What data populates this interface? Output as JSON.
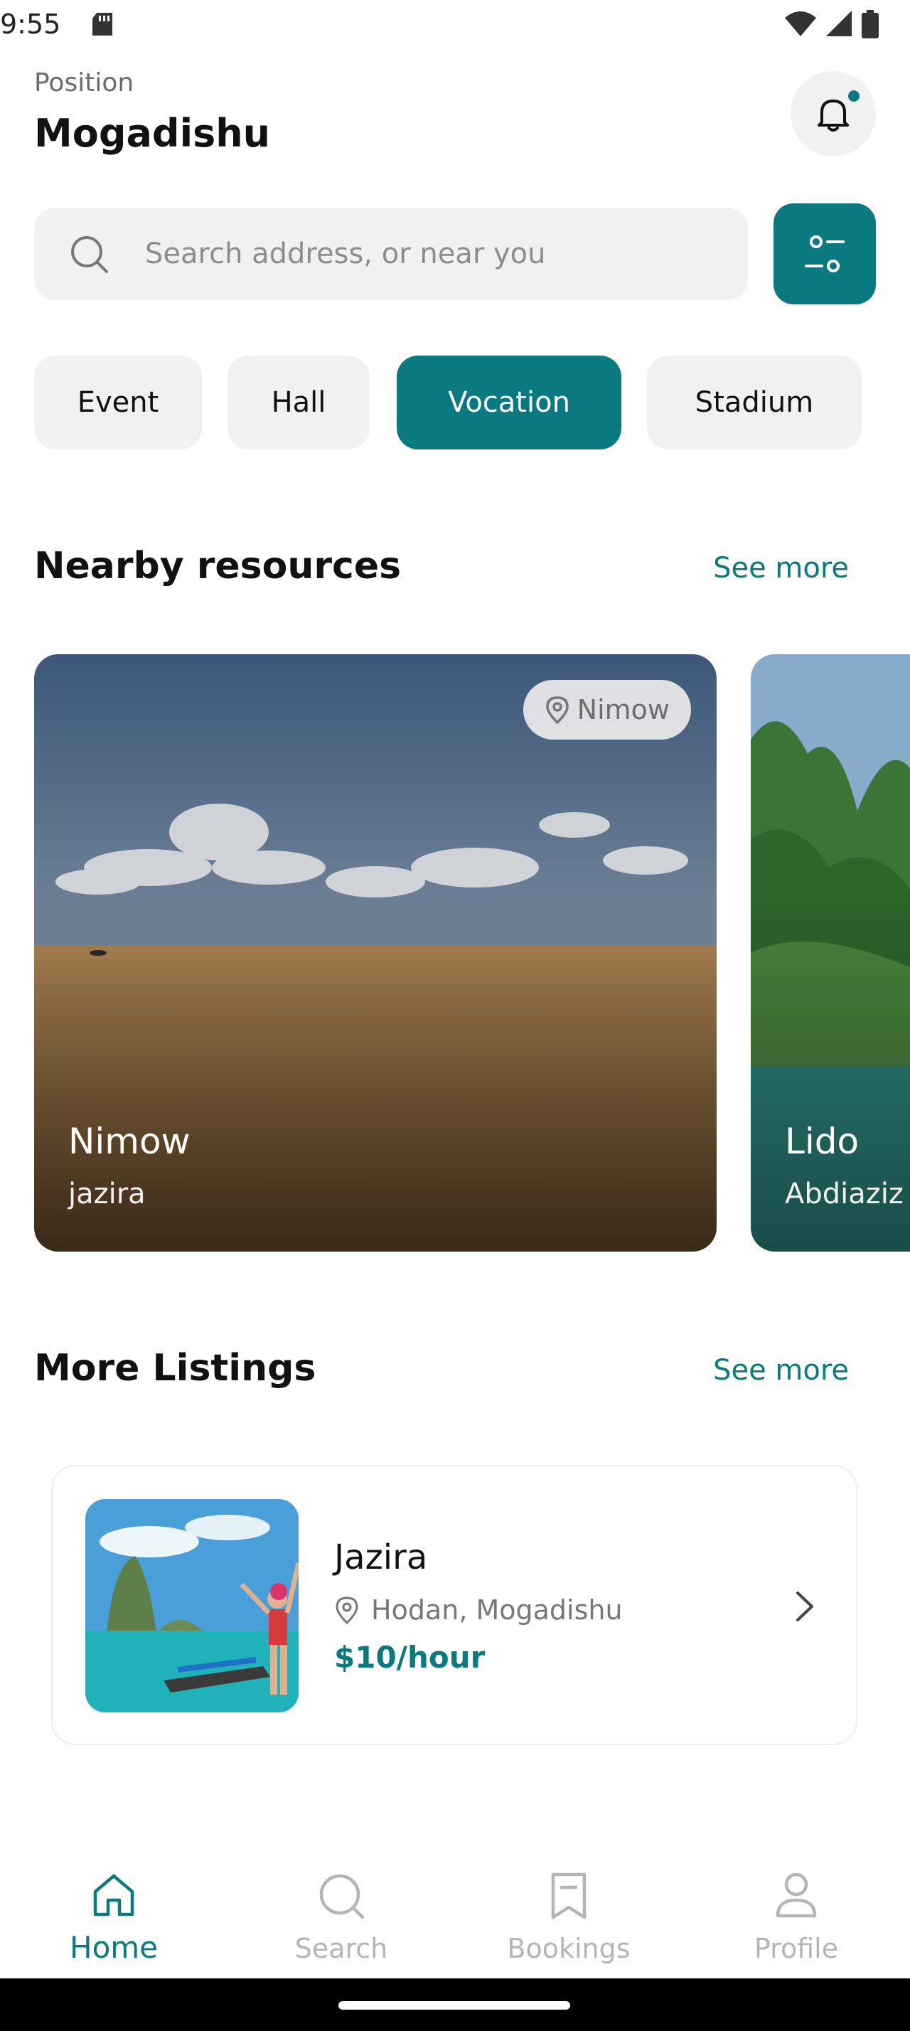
{
  "status": {
    "time": "9:55"
  },
  "header": {
    "position_label": "Position",
    "city": "Mogadishu"
  },
  "search": {
    "placeholder": "Search address, or near you",
    "value": ""
  },
  "categories": [
    {
      "label": "Event",
      "active": false
    },
    {
      "label": "Hall",
      "active": false
    },
    {
      "label": "Vocation",
      "active": true
    },
    {
      "label": "Stadium",
      "active": false
    }
  ],
  "nearby": {
    "title": "Nearby resources",
    "see_more": "See more",
    "cards": [
      {
        "tag": "Nimow",
        "title": "Nimow",
        "subtitle": "jazira"
      },
      {
        "title": "Lido",
        "subtitle": "Abdiaziz"
      }
    ]
  },
  "listings": {
    "title": "More Listings",
    "see_more": "See more",
    "items": [
      {
        "title": "Jazira",
        "location": "Hodan, Mogadishu",
        "price": "$10/hour"
      }
    ]
  },
  "nav": {
    "items": [
      {
        "label": "Home",
        "icon": "home-icon",
        "active": true
      },
      {
        "label": "Search",
        "icon": "search-icon",
        "active": false
      },
      {
        "label": "Bookings",
        "icon": "bookmark-icon",
        "active": false
      },
      {
        "label": "Profile",
        "icon": "profile-icon",
        "active": false
      }
    ]
  },
  "colors": {
    "accent": "#0b7a80",
    "chip_bg": "#f1f1f1",
    "muted_text": "#8d8d8d"
  }
}
